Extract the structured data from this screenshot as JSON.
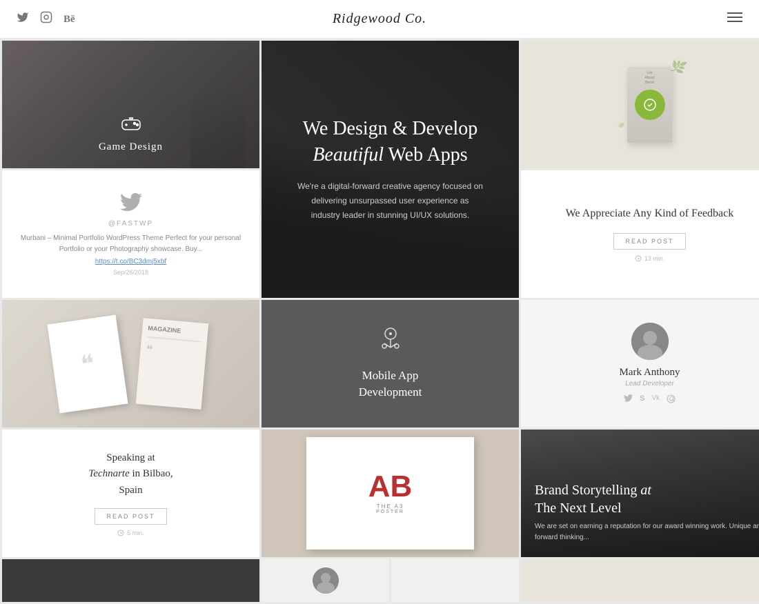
{
  "header": {
    "logo": "Ridgewood Co.",
    "menu_icon": "≡",
    "social": [
      {
        "name": "twitter",
        "icon": "🐦"
      },
      {
        "name": "instagram",
        "icon": "📷"
      },
      {
        "name": "behance",
        "icon": "Bē"
      }
    ]
  },
  "grid": {
    "cells": {
      "game_design": {
        "icon": "🎮",
        "title": "Game Design"
      },
      "hero": {
        "heading_line1": "We Design & Develop",
        "heading_italic": "Beautiful",
        "heading_line2": "Web Apps",
        "description": "We're a digital-forward creative agency focused on delivering unsurpassed user experience as industry leader in stunning UI/UX solutions."
      },
      "twitter": {
        "handle": "@FASTWP",
        "text": "Murbani – Minimal Portfolio WordPress Theme Perfect for your personal Portfolio or your Photography showcase. Buy...",
        "link": "https://t.co/BC3dmj5xbf",
        "date": "Sep/26/2018"
      },
      "feedback": {
        "title": "We Appreciate Any Kind of Feedback",
        "button": "READ POST",
        "time": "13 min."
      },
      "mobile_app": {
        "icon": "⚗",
        "title": "Mobile App\nDevelopment"
      },
      "profile": {
        "name": "Mark Anthony",
        "role": "Lead Developer",
        "social_icons": [
          "🐦",
          "S",
          "Vk",
          "W"
        ]
      },
      "speaking": {
        "title": "Speaking at\nTechnarte in Bilbao,\nSpain",
        "button": "READ POST",
        "time": "5 min."
      },
      "brand": {
        "title_line1": "Brand Storytelling",
        "title_italic": "at",
        "title_line2": "The Next Level",
        "description": "We are set on earning a reputation for our award winning work. Unique and forward thinking..."
      }
    }
  }
}
